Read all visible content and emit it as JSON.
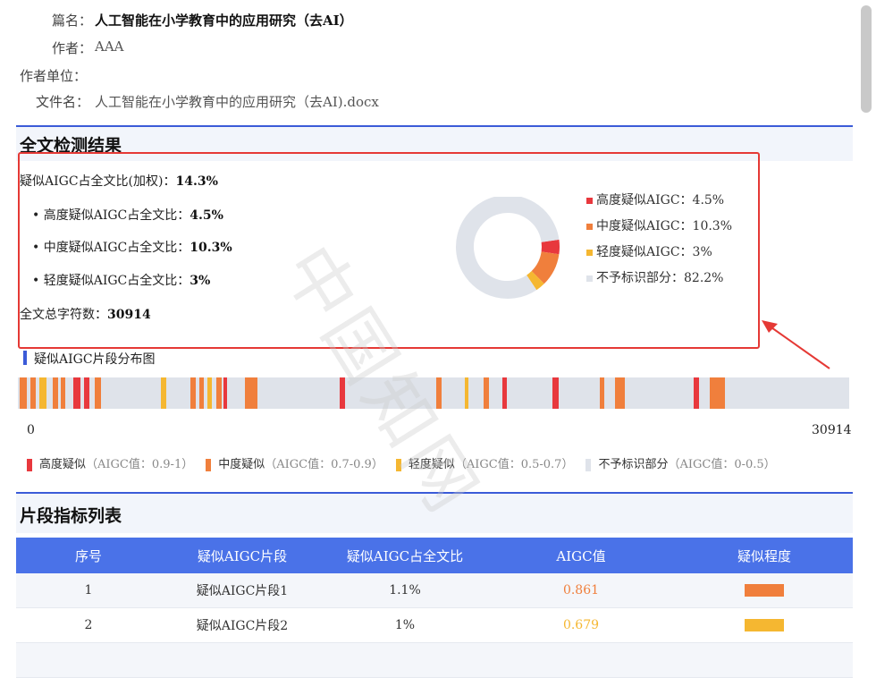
{
  "meta": {
    "title_label": "篇名：",
    "title_value": "人工智能在小学教育中的应用研究（去AI）",
    "author_label": "作者：",
    "author_value": "AAA",
    "unit_label": "作者单位：",
    "file_label": "文件名：",
    "file_value": "人工智能在小学教育中的应用研究（去AI).docx"
  },
  "summary": {
    "section_title": "全文检测结果",
    "weighted_label": "疑似AIGC占全文比(加权)：",
    "weighted_value": "14.3%",
    "high_label": "• 高度疑似AIGC占全文比：",
    "high_value": "4.5%",
    "mid_label": "• 中度疑似AIGC占全文比：",
    "mid_value": "10.3%",
    "low_label": "• 轻度疑似AIGC占全文比：",
    "low_value": "3%",
    "total_label": "全文总字符数：",
    "total_value": "30914"
  },
  "chart_data": {
    "type": "pie",
    "categories": [
      "高度疑似AIGC",
      "中度疑似AIGC",
      "轻度疑似AIGC",
      "不予标识部分"
    ],
    "values": [
      4.5,
      10.3,
      3,
      82.2
    ],
    "colors": [
      "#e8383d",
      "#f07f3c",
      "#f5b731",
      "#dfe3ea"
    ],
    "legend": [
      "高度疑似AIGC：4.5%",
      "中度疑似AIGC：10.3%",
      "轻度疑似AIGC：3%",
      "不予标识部分：82.2%"
    ],
    "legend_position": "right"
  },
  "distribution": {
    "title": "疑似AIGC片段分布图",
    "start_label": "0",
    "end_label": "30914",
    "total": 30914,
    "legend": [
      {
        "name": "高度疑似",
        "range": "（AIGC值：0.9-1）",
        "color": "#e8383d"
      },
      {
        "name": "中度疑似",
        "range": "（AIGC值：0.7-0.9）",
        "color": "#f07f3c"
      },
      {
        "name": "轻度疑似",
        "range": "（AIGC值：0.5-0.7）",
        "color": "#f5b731"
      },
      {
        "name": "不予标识部分",
        "range": "（AIGC值：0-0.5）",
        "color": "#dfe3ea"
      }
    ],
    "colors": {
      "high": "#e8383d",
      "mid": "#f07f3c",
      "low": "#f5b731"
    }
  },
  "fragment_table": {
    "section_title": "片段指标列表",
    "headers": [
      "序号",
      "疑似AIGC片段",
      "疑似AIGC占全文比",
      "AIGC值",
      "疑似程度"
    ],
    "rows": [
      {
        "index": "1",
        "name": "疑似AIGC片段1",
        "ratio": "1.1%",
        "value": "0.861",
        "value_color": "#f07f3c",
        "level_color": "#f07f3c"
      },
      {
        "index": "2",
        "name": "疑似AIGC片段2",
        "ratio": "1%",
        "value": "0.679",
        "value_color": "#f5b731",
        "level_color": "#f5b731"
      }
    ]
  },
  "watermark": "中国知网"
}
